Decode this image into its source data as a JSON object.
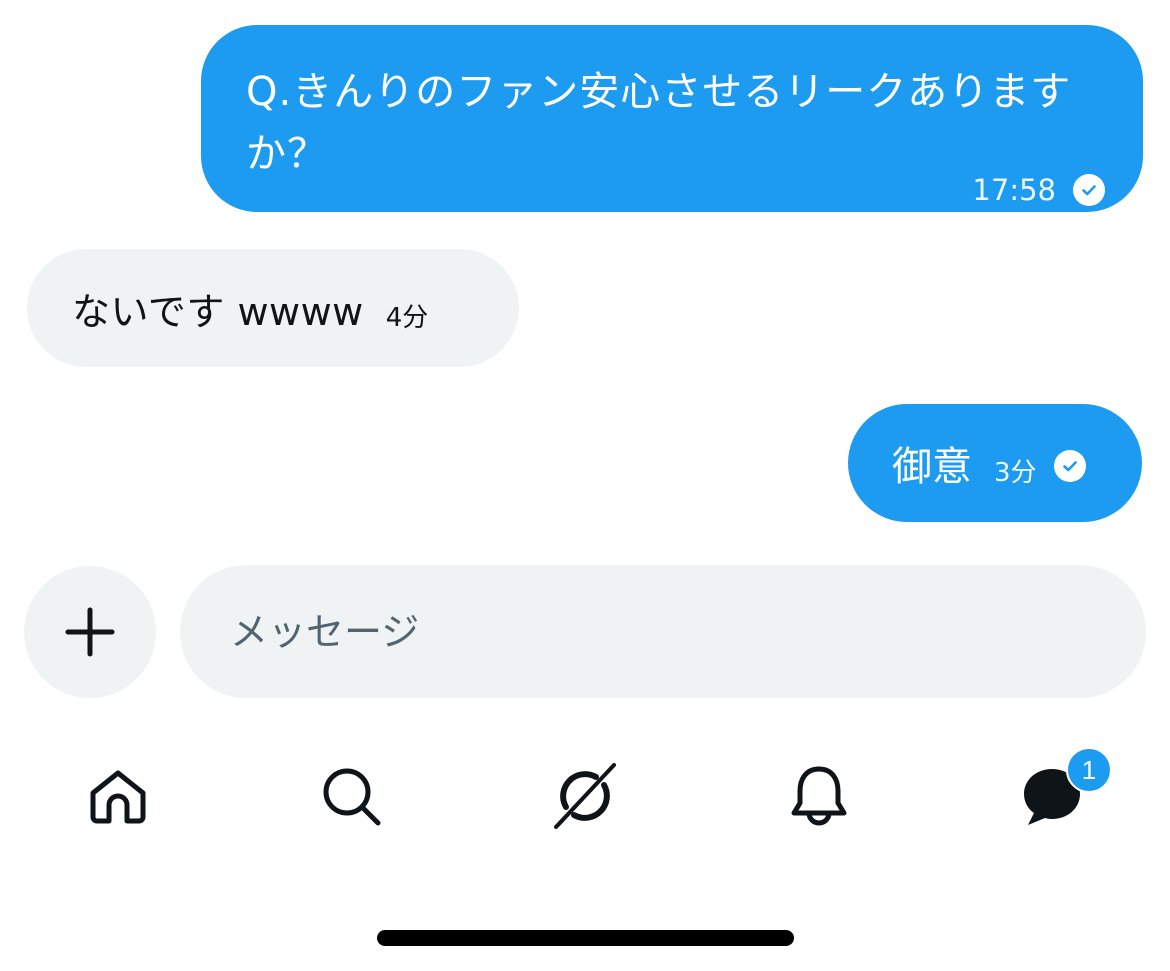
{
  "messages": [
    {
      "direction": "outgoing",
      "text": "Q.きんりのファン安心させるリークありますか？",
      "time": "17:58",
      "read": true
    },
    {
      "direction": "incoming",
      "text": "ないです wwww",
      "time": "4分"
    },
    {
      "direction": "outgoing",
      "text": "御意",
      "time": "3分",
      "read": true
    }
  ],
  "composer": {
    "placeholder": "メッセージ",
    "value": ""
  },
  "nav": {
    "items": [
      {
        "icon": "home-icon"
      },
      {
        "icon": "search-icon"
      },
      {
        "icon": "grok-icon"
      },
      {
        "icon": "bell-icon"
      },
      {
        "icon": "messages-icon",
        "badge": "1"
      }
    ]
  },
  "colors": {
    "accent": "#1d9bf0",
    "incoming_bubble": "#eff3f4",
    "text": "#0f1419",
    "placeholder": "#536471"
  }
}
